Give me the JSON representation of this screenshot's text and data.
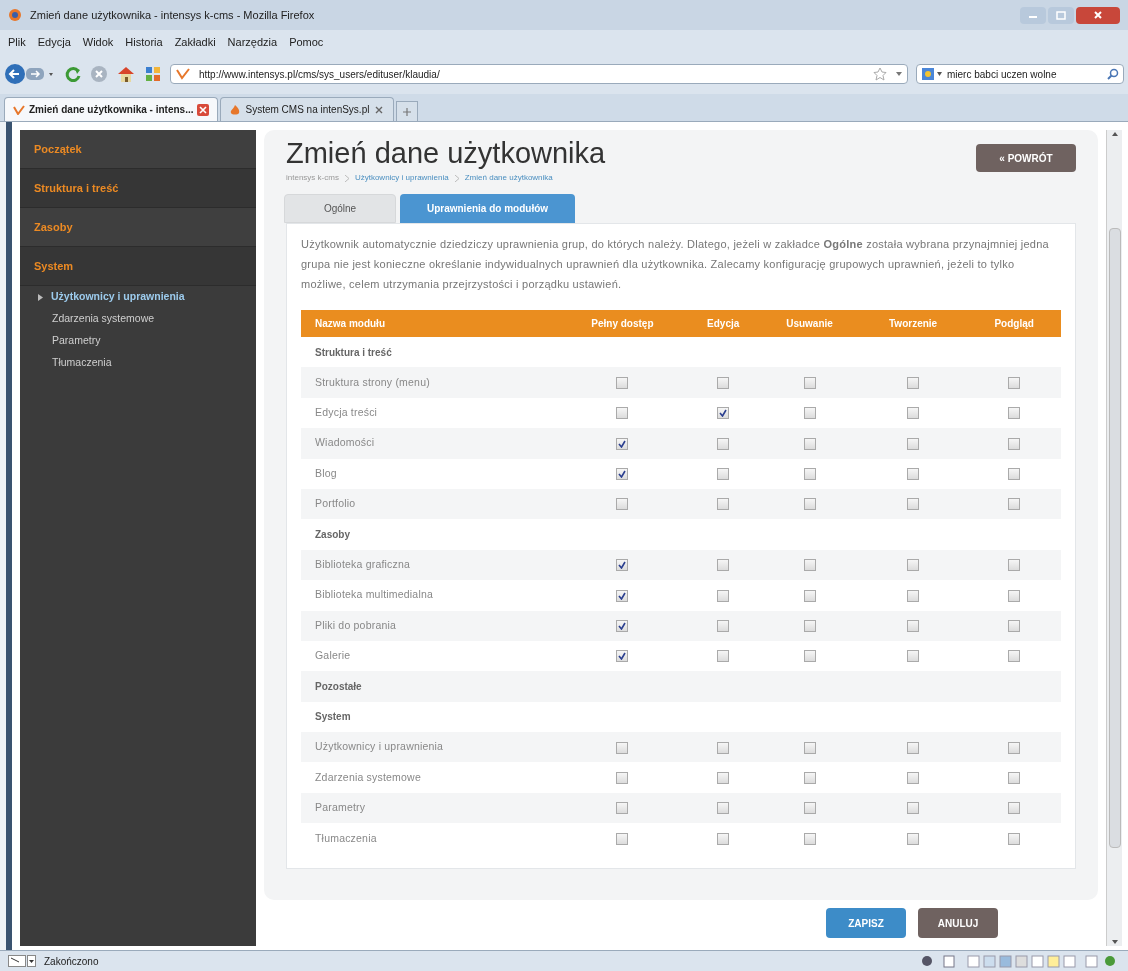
{
  "window": {
    "title": "Zmień dane użytkownika - intensys k-cms - Mozilla Firefox"
  },
  "menu": [
    "Plik",
    "Edycja",
    "Widok",
    "Historia",
    "Zakładki",
    "Narzędzia",
    "Pomoc"
  ],
  "address_bar": {
    "url": "http://www.intensys.pl/cms/sys_users/edituser/klaudia/"
  },
  "search_field": {
    "value": "mierc babci uczen wolne"
  },
  "browser_tabs": [
    {
      "label": "Zmień dane użytkownika - intens...",
      "selected": true
    },
    {
      "label": "System CMS na intenSys.pl",
      "selected": false
    }
  ],
  "sidebar": {
    "items": [
      {
        "label": "Początek",
        "kind": "section"
      },
      {
        "label": "Struktura i treść",
        "kind": "section"
      },
      {
        "label": "Zasoby",
        "kind": "section"
      },
      {
        "label": "System",
        "kind": "section"
      },
      {
        "label": "Użytkownicy i uprawnienia",
        "kind": "sub",
        "selected": true
      },
      {
        "label": "Zdarzenia systemowe",
        "kind": "sub",
        "selected": false
      },
      {
        "label": "Parametry",
        "kind": "sub",
        "selected": false
      },
      {
        "label": "Tłumaczenia",
        "kind": "sub",
        "selected": false
      }
    ]
  },
  "page": {
    "title": "Zmień dane użytkownika",
    "breadcrumbs": [
      "intensys k-cms",
      "Użytkownicy i uprawnienia",
      "Zmień dane użytkownika"
    ],
    "back_button": "« POWRÓT",
    "tabs": [
      {
        "label": "Ogólne",
        "selected": false
      },
      {
        "label": "Uprawnienia do modułów",
        "selected": true
      }
    ],
    "intro": "Użytkownik automatycznie dziedziczy uprawnienia grup, do których należy. Dlatego, jeżeli w zakładce **Ogólne** została wybrana przynajmniej jedna grupa nie jest konieczne określanie indywidualnych uprawnień dla użytkownika. Zalecamy konfigurację grupowych uprawnień, jeżeli to tylko możliwe, celem utrzymania przejrzystości i porządku ustawień.",
    "table": {
      "columns": [
        "Nazwa modułu",
        "Pełny dostęp",
        "Edycja",
        "Usuwanie",
        "Tworzenie",
        "Podgląd"
      ],
      "rows": [
        {
          "kind": "group",
          "label": "Struktura i treść"
        },
        {
          "kind": "module",
          "label": "Struktura strony (menu)",
          "perms": [
            false,
            false,
            false,
            false,
            false
          ]
        },
        {
          "kind": "module",
          "label": "Edycja treści",
          "perms": [
            false,
            true,
            false,
            false,
            false
          ]
        },
        {
          "kind": "module",
          "label": "Wiadomości",
          "perms": [
            true,
            false,
            false,
            false,
            false
          ]
        },
        {
          "kind": "module",
          "label": "Blog",
          "perms": [
            true,
            false,
            false,
            false,
            false
          ]
        },
        {
          "kind": "module",
          "label": "Portfolio",
          "perms": [
            false,
            false,
            false,
            false,
            false
          ]
        },
        {
          "kind": "group",
          "label": "Zasoby"
        },
        {
          "kind": "module",
          "label": "Biblioteka graficzna",
          "perms": [
            true,
            false,
            false,
            false,
            false
          ]
        },
        {
          "kind": "module",
          "label": "Biblioteka multimedialna",
          "perms": [
            true,
            false,
            false,
            false,
            false
          ]
        },
        {
          "kind": "module",
          "label": "Pliki do pobrania",
          "perms": [
            true,
            false,
            false,
            false,
            false
          ]
        },
        {
          "kind": "module",
          "label": "Galerie",
          "perms": [
            true,
            false,
            false,
            false,
            false
          ]
        },
        {
          "kind": "group",
          "label": "Pozostałe"
        },
        {
          "kind": "group",
          "label": "System"
        },
        {
          "kind": "module",
          "label": "Użytkownicy i uprawnienia",
          "perms": [
            false,
            false,
            false,
            false,
            false
          ]
        },
        {
          "kind": "module",
          "label": "Zdarzenia systemowe",
          "perms": [
            false,
            false,
            false,
            false,
            false
          ]
        },
        {
          "kind": "module",
          "label": "Parametry",
          "perms": [
            false,
            false,
            false,
            false,
            false
          ]
        },
        {
          "kind": "module",
          "label": "Tłumaczenia",
          "perms": [
            false,
            false,
            false,
            false,
            false
          ]
        }
      ]
    },
    "buttons": [
      {
        "label": "ZAPISZ",
        "kind": "primary"
      },
      {
        "label": "ANULUJ",
        "kind": "secondary"
      }
    ]
  },
  "status_bar": {
    "text": "Zakończono"
  }
}
